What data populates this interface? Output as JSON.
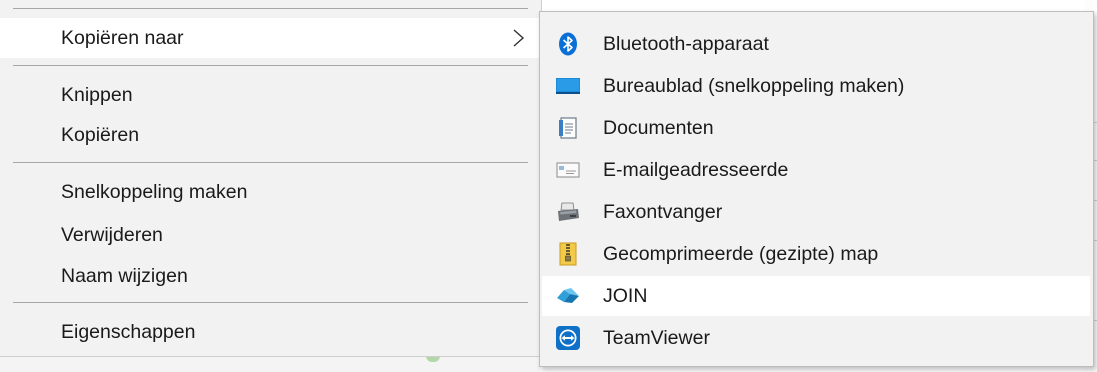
{
  "context_menu": {
    "items": [
      {
        "label": "Kopiëren naar",
        "has_submenu": true
      },
      {
        "label": "Knippen"
      },
      {
        "label": "Kopiëren"
      },
      {
        "label": "Snelkoppeling maken"
      },
      {
        "label": "Verwijderen"
      },
      {
        "label": "Naam wijzigen"
      },
      {
        "label": "Eigenschappen"
      }
    ]
  },
  "submenu": {
    "items": [
      {
        "label": "Bluetooth-apparaat",
        "icon": "bluetooth-icon"
      },
      {
        "label": "Bureaublad (snelkoppeling maken)",
        "icon": "desktop-icon"
      },
      {
        "label": "Documenten",
        "icon": "documents-icon"
      },
      {
        "label": "E-mailgeadresseerde",
        "icon": "mail-recipient-icon"
      },
      {
        "label": "Faxontvanger",
        "icon": "fax-icon"
      },
      {
        "label": "Gecomprimeerde (gezipte) map",
        "icon": "zip-folder-icon"
      },
      {
        "label": "JOIN",
        "icon": "join-icon"
      },
      {
        "label": "TeamViewer",
        "icon": "teamviewer-icon"
      }
    ]
  },
  "colors": {
    "menu_bg": "#f2f2f2",
    "highlight_bg": "#ffffff",
    "separator": "#a7a7a7",
    "bluetooth_blue": "#0a6fd6",
    "teamviewer_blue": "#0e70c7"
  }
}
